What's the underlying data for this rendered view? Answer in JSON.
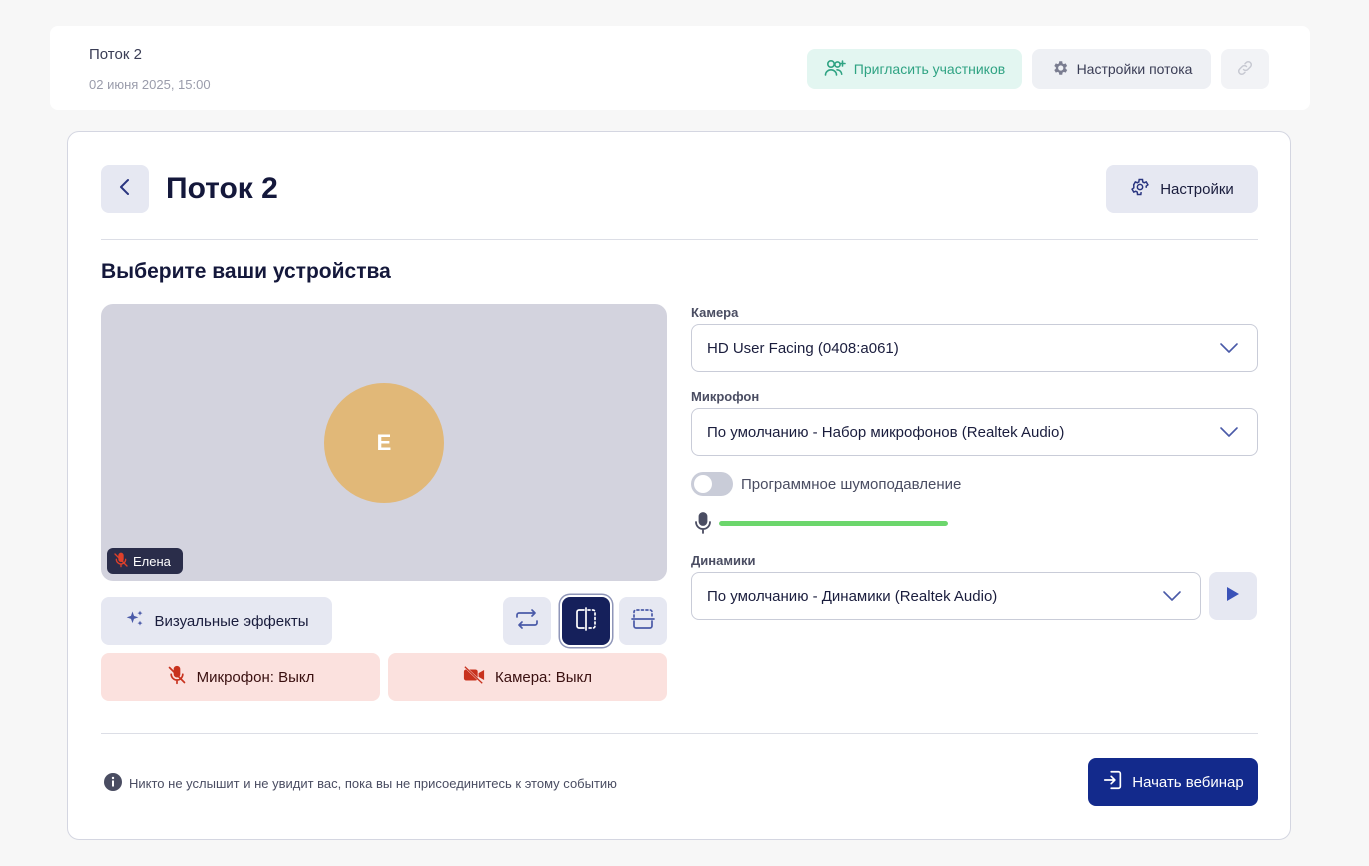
{
  "topbar": {
    "title": "Поток 2",
    "date": "02 июня 2025, 15:00",
    "invite_label": "Пригласить участников",
    "stream_settings_label": "Настройки потока"
  },
  "header": {
    "title": "Поток 2",
    "settings_label": "Настройки"
  },
  "devices": {
    "section_title": "Выберите ваши устройства",
    "preview": {
      "avatar_initial": "Е",
      "participant_name": "Елена"
    },
    "effects_label": "Визуальные эффекты",
    "mic_toggle_label": "Микрофон: Выкл",
    "camera_toggle_label": "Камера: Выкл",
    "camera": {
      "label": "Камера",
      "selected": "HD User Facing (0408:a061)"
    },
    "microphone": {
      "label": "Микрофон",
      "selected": "По умолчанию - Набор микрофонов (Realtek Audio)"
    },
    "noise_suppression": {
      "label": "Программное шумоподавление",
      "enabled": false
    },
    "mic_level": 1.0,
    "speakers": {
      "label": "Динамики",
      "selected": "По умолчанию - Динамики (Realtek Audio)"
    }
  },
  "footer": {
    "notice": "Никто не услышит и не увидит вас, пока вы не присоединитесь к этому событию",
    "start_label": "Начать вебинар"
  },
  "colors": {
    "accent": "#132a8c",
    "invite": "#2fa383",
    "off_bg": "#fbe1de",
    "off_icon": "#c8321e",
    "level": "#6cd66c",
    "avatar": "#e1b878"
  }
}
